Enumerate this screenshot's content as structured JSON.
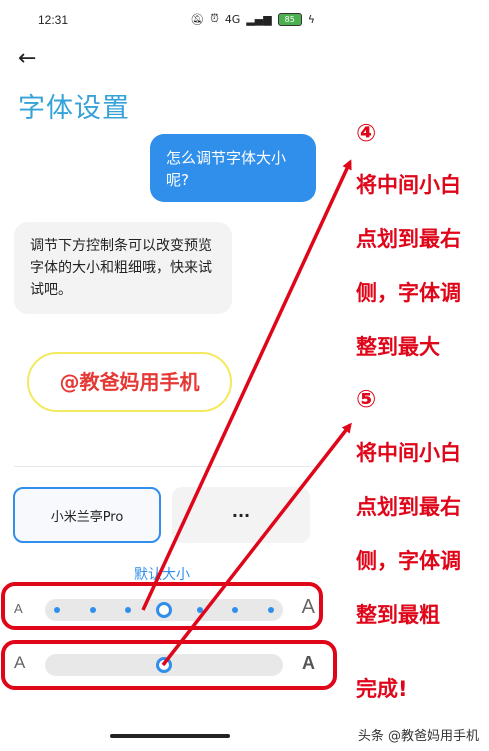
{
  "status_bar": {
    "time": "12:31",
    "signal": "4G",
    "battery": "85",
    "icons": [
      "mute-icon",
      "alarm-icon",
      "signal-icon",
      "battery-icon",
      "charging-icon"
    ]
  },
  "page": {
    "back_icon": "←",
    "title": "字体设置"
  },
  "chat": {
    "question": "怎么调节字体大小呢?",
    "answer": "调节下方控制条可以改变预览字体的大小和粗细哦，快来试试吧。"
  },
  "watermark": "@教爸妈用手机",
  "font_options": {
    "selected": "小米兰亭Pro",
    "more": "···"
  },
  "size_label": "默认大小",
  "size_slider": {
    "small_label": "A",
    "large_label": "A",
    "steps": 7,
    "value_step": 3
  },
  "weight_slider": {
    "small_label": "A",
    "large_label": "A",
    "value": 0.5
  },
  "annotations": {
    "step4_marker": "④",
    "step4_lines": [
      "将中间小白",
      "点划到最右",
      "侧，字体调",
      "整到最大"
    ],
    "step5_marker": "⑤",
    "step5_lines": [
      "将中间小白",
      "点划到最右",
      "侧，字体调",
      "整到最粗"
    ],
    "done": "完成!"
  },
  "footer": "头条 @教爸妈用手机",
  "colors": {
    "accent": "#2f8fea",
    "title": "#35a2d8",
    "annotation": "#e0061a"
  }
}
